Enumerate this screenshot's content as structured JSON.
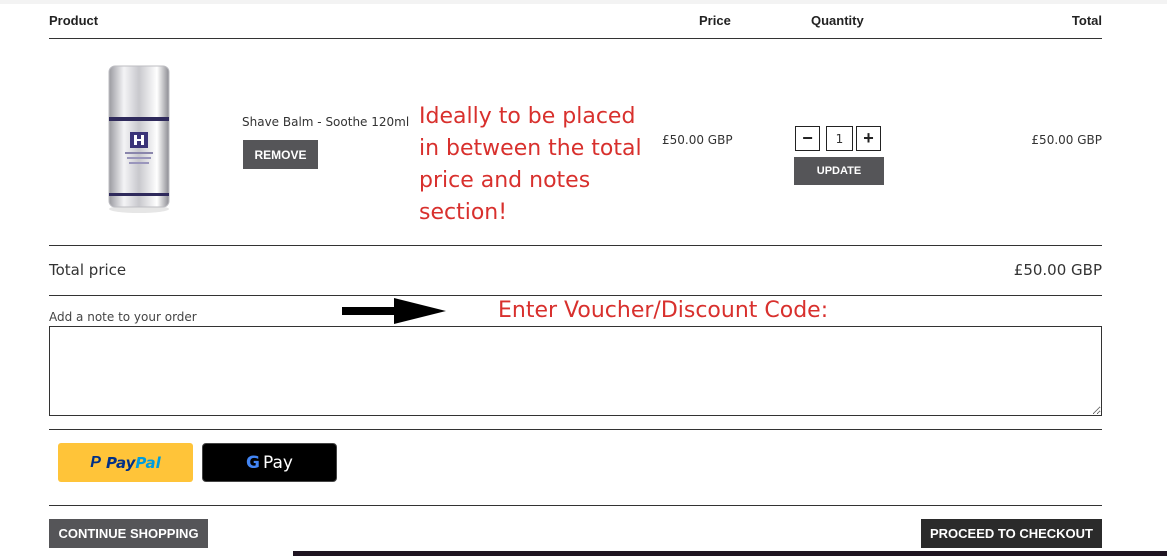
{
  "table_header": {
    "product": "Product",
    "price": "Price",
    "quantity": "Quantity",
    "total": "Total"
  },
  "item": {
    "name": "Shave Balm - Soothe 120ml",
    "remove_label": "REMOVE",
    "price": "£50.00 GBP",
    "quantity": "1",
    "minus_symbol": "−",
    "plus_symbol": "+",
    "update_label": "UPDATE",
    "line_total": "£50.00 GBP",
    "image": "product-bottle-image"
  },
  "annotations": {
    "note_1": "Ideally to be placed in between the total price and notes section!",
    "note_2": "Enter Voucher/Discount Code:",
    "color": "#d8302d"
  },
  "summary": {
    "total_label": "Total price",
    "total_value": "£50.00 GBP"
  },
  "order_note": {
    "label": "Add a note to your order",
    "value": ""
  },
  "payments": {
    "paypal_pay": "Pay",
    "paypal_pal": "Pal",
    "paypal_mark": "P",
    "gpay_g": "G",
    "gpay_pay": "Pay"
  },
  "footer": {
    "continue_label": "CONTINUE SHOPPING",
    "checkout_label": "PROCEED TO CHECKOUT"
  },
  "colors": {
    "button_dark": "#555558",
    "checkout_dark": "#2b2b2b",
    "paypal_yellow": "#ffc439",
    "paypal_blue_dark": "#003087",
    "paypal_blue_light": "#009cde"
  }
}
